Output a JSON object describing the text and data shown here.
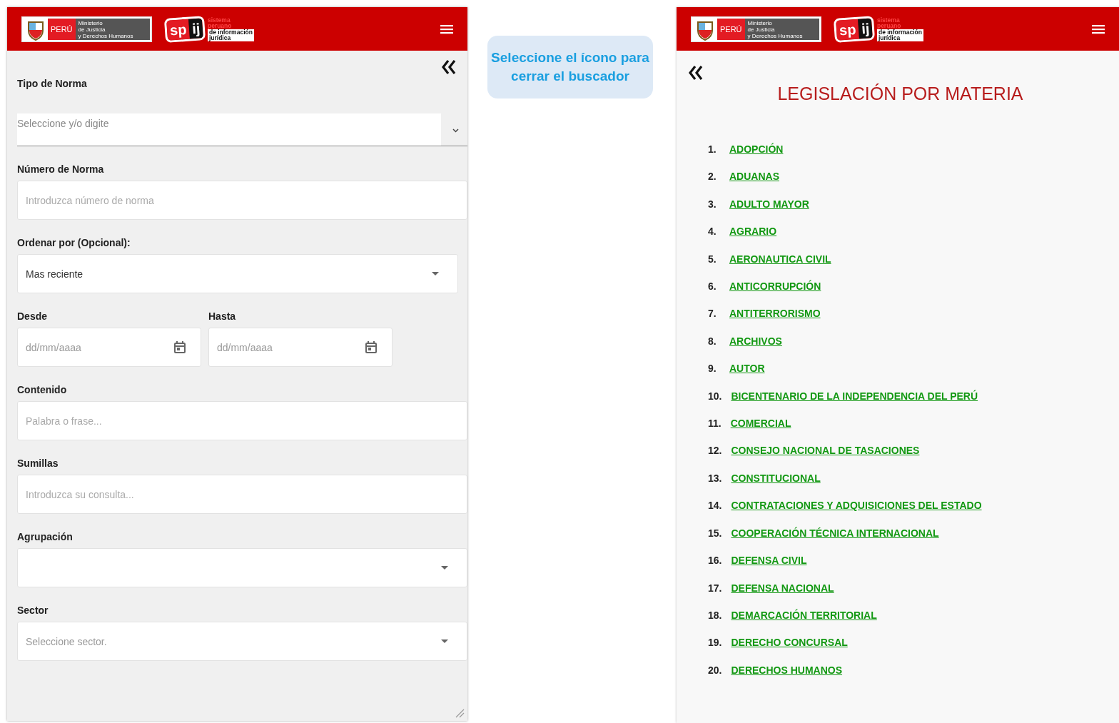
{
  "left_panel": {
    "header": {
      "ministry_logo": {
        "country": "PERÚ",
        "ministry_lines": [
          "Ministerio",
          "de Justicia",
          "y Derechos Humanos"
        ]
      },
      "spij_logo": {
        "mark": [
          "sp",
          "ij"
        ],
        "tagline_lines": [
          "sistema",
          "peruano",
          "de información",
          "jurídica"
        ]
      }
    },
    "fields": [
      {
        "kind": "combo",
        "label": "Tipo de Norma",
        "placeholder": "Seleccione y/o digite"
      },
      {
        "kind": "input",
        "label": "Número de Norma",
        "placeholder": "Introduzca número de norma"
      },
      {
        "kind": "select",
        "label": "Ordenar por (Opcional):",
        "value": "Mas reciente"
      },
      {
        "kind": "dates",
        "items": [
          {
            "label": "Desde",
            "placeholder": "dd/mm/aaaa"
          },
          {
            "label": "Hasta",
            "placeholder": "dd/mm/aaaa"
          }
        ]
      },
      {
        "kind": "input",
        "label": "Contenido",
        "placeholder": "Palabra o frase..."
      },
      {
        "kind": "input",
        "label": "Sumillas",
        "placeholder": "Introduzca su consulta..."
      },
      {
        "kind": "select",
        "label": "Agrupación"
      },
      {
        "kind": "select",
        "label": "Sector",
        "placeholder": "Seleccione sector."
      }
    ]
  },
  "callout": {
    "text": "Seleccione el ícono para cerrar el buscador"
  },
  "right_panel": {
    "header": {
      "ministry_logo": {
        "country": "PERÚ",
        "ministry_lines": [
          "Ministerio",
          "de Justicia",
          "y Derechos Humanos"
        ]
      },
      "spij_logo": {
        "mark": [
          "sp",
          "ij"
        ],
        "tagline_lines": [
          "sistema",
          "peruano",
          "de información",
          "jurídica"
        ]
      }
    },
    "title": "LEGISLACIÓN POR MATERIA",
    "items": [
      {
        "number": "1.",
        "label": "ADOPCIÓN"
      },
      {
        "number": "2.",
        "label": "ADUANAS"
      },
      {
        "number": "3.",
        "label": "ADULTO MAYOR"
      },
      {
        "number": "4.",
        "label": "AGRARIO"
      },
      {
        "number": "5.",
        "label": "AERONAUTICA CIVIL"
      },
      {
        "number": "6.",
        "label": "ANTICORRUPCIÓN"
      },
      {
        "number": "7.",
        "label": "ANTITERRORISMO"
      },
      {
        "number": "8.",
        "label": "ARCHIVOS"
      },
      {
        "number": "9.",
        "label": "AUTOR"
      },
      {
        "number": "10.",
        "label": "BICENTENARIO DE LA INDEPENDENCIA DEL PERÚ"
      },
      {
        "number": "11.",
        "label": "COMERCIAL"
      },
      {
        "number": "12.",
        "label": "CONSEJO NACIONAL DE TASACIONES"
      },
      {
        "number": "13.",
        "label": "CONSTITUCIONAL"
      },
      {
        "number": "14.",
        "label": "CONTRATACIONES Y ADQUISICIONES DEL ESTADO"
      },
      {
        "number": "15.",
        "label": "COOPERACIÓN TÉCNICA INTERNACIONAL"
      },
      {
        "number": "16.",
        "label": "DEFENSA CIVIL"
      },
      {
        "number": "17.",
        "label": "DEFENSA NACIONAL"
      },
      {
        "number": "18.",
        "label": "DEMARCACIÓN TERRITORIAL"
      },
      {
        "number": "19.",
        "label": "DERECHO CONCURSAL"
      },
      {
        "number": "20.",
        "label": "DERECHOS HUMANOS"
      }
    ]
  }
}
